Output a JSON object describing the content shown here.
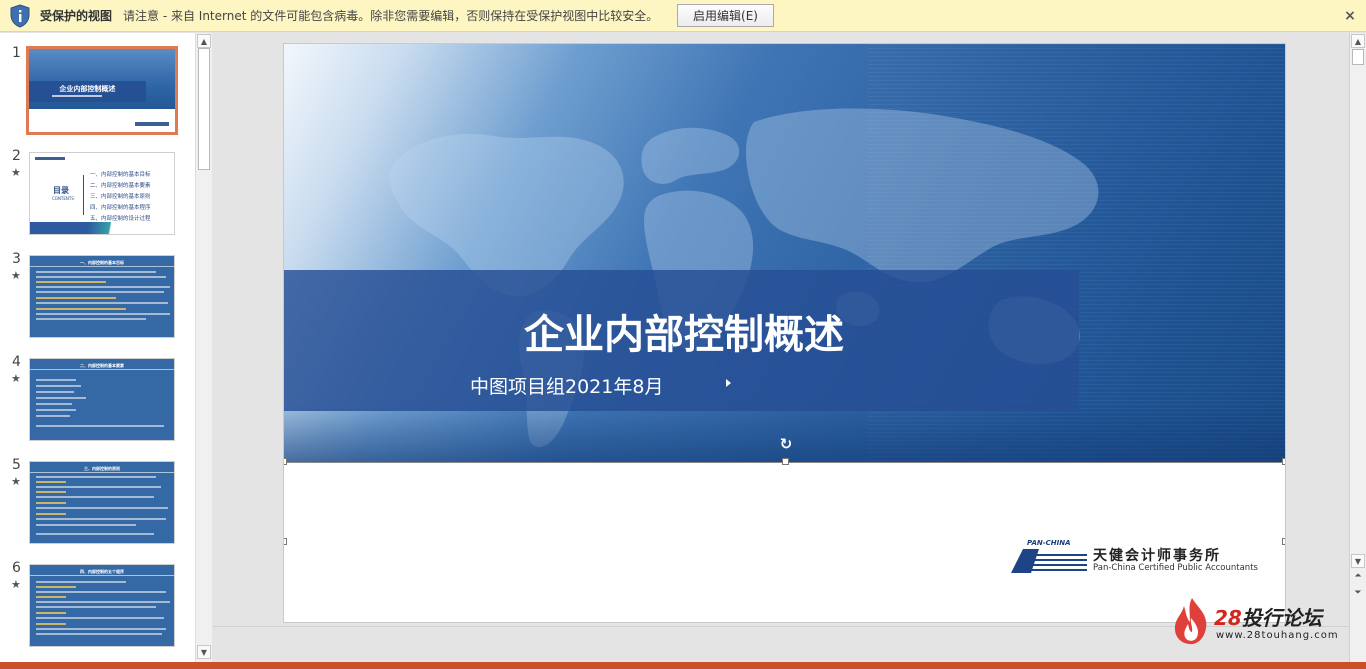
{
  "protected_view": {
    "title": "受保护的视图",
    "message": "请注意 - 来自 Internet 的文件可能包含病毒。除非您需要编辑，否则保持在受保护视图中比较安全。",
    "enable_button": "启用编辑(E)",
    "close": "×"
  },
  "thumbnails": [
    {
      "num": "1",
      "star": "",
      "title": "企业内部控制概述"
    },
    {
      "num": "2",
      "star": "★",
      "title": "目录",
      "subtitle": "CONTENTS",
      "items": [
        "一、内部控制的基本目标",
        "二、内部控制的基本要素",
        "三、内部控制的基本原则",
        "四、内部控制的基本程序",
        "五、内部控制的设计过程"
      ]
    },
    {
      "num": "3",
      "star": "★",
      "title": "一、内部控制的基本目标"
    },
    {
      "num": "4",
      "star": "★",
      "title": "二、内部控制的基本要素"
    },
    {
      "num": "5",
      "star": "★",
      "title": "三、内部控制的原则"
    },
    {
      "num": "6",
      "star": "★",
      "title": "四、内部控制的五个程序"
    }
  ],
  "slide": {
    "title": "企业内部控制概述",
    "subtitle": "中图项目组2021年8月",
    "logo_brand": "PAN-CHINA",
    "logo_cn": "天健会计师事务所",
    "logo_en": "Pan-China  Certified  Public  Accountants"
  },
  "watermark": {
    "num": "28",
    "text": "投行论坛",
    "url": "www.28touhang.com"
  },
  "colors": {
    "accent": "#c8502a",
    "selected_thumb_border": "#e07a52",
    "slide_band": "#264e94"
  }
}
